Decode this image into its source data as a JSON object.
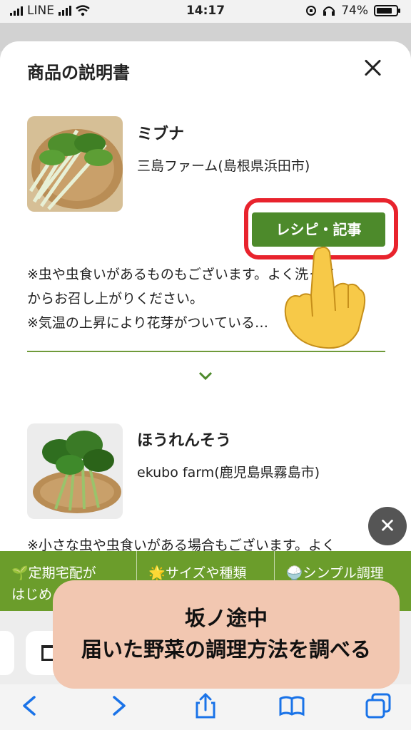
{
  "status_bar": {
    "carrier": "LINE",
    "time": "14:17",
    "battery": "74%"
  },
  "sheet": {
    "title": "商品の説明書"
  },
  "products": [
    {
      "name": "ミブナ",
      "farm": "三島ファーム(島根県浜田市)",
      "recipe_button": "レシピ・記事",
      "desc_lines": [
        "※虫や虫食いがあるものもございます。よく洗って",
        "からお召し上がりください。",
        "※気温の上昇により花芽がついている…"
      ]
    },
    {
      "name": "ほうれんそう",
      "farm": "ekubo farm(鹿児島県霧島市)",
      "desc_lines": [
        "※小さな虫や虫食いがある場合もございます。よく"
      ]
    }
  ],
  "promo_tabs": [
    {
      "icon": "sprout-icon",
      "line1": "🌱定期宅配が",
      "line2": "はじめ"
    },
    {
      "icon": "star-icon",
      "line1": "🌟サイズや種類",
      "line2": ""
    },
    {
      "icon": "rice-bowl-icon",
      "line1": "🍚シンプル調理",
      "line2": ""
    }
  ],
  "caption": {
    "line1": "坂ノ途中",
    "line2": "届いた野菜の調理方法を調べる"
  },
  "colors": {
    "accent_green": "#4d8a2b",
    "highlight_red": "#e8232d",
    "caption_bg": "#f2c7b1",
    "toolbar_blue": "#1a73e8"
  }
}
